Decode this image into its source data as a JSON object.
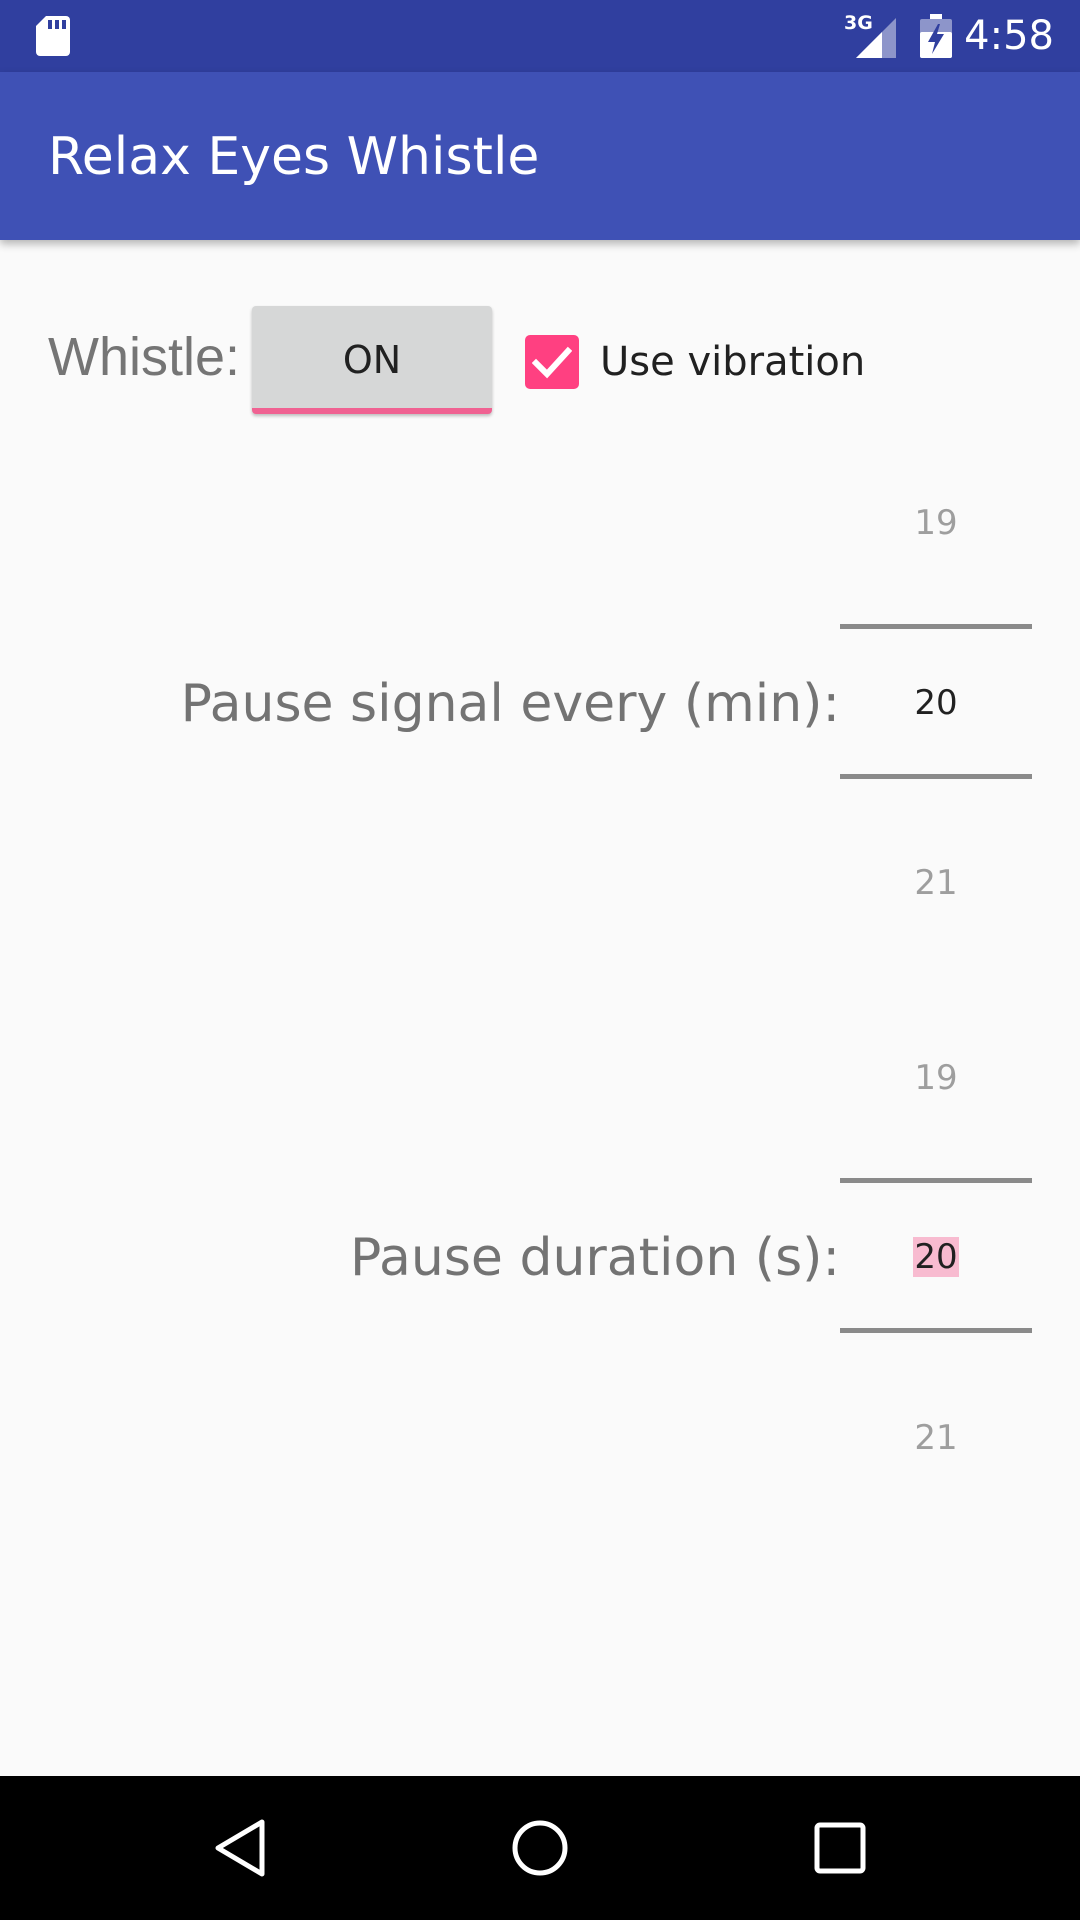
{
  "status_bar": {
    "time": "4:58",
    "network": "3G",
    "icons": [
      "sd-card-icon",
      "signal-icon",
      "battery-charging-icon"
    ]
  },
  "app_bar": {
    "title": "Relax Eyes Whistle"
  },
  "whistle": {
    "label": "Whistle:",
    "toggle_label": "ON",
    "vibration_label": "Use vibration",
    "vibration_checked": true
  },
  "pause_interval": {
    "label": "Pause signal every (min):",
    "prev": "19",
    "value": "20",
    "next": "21"
  },
  "pause_duration": {
    "label": "Pause duration (s):",
    "prev": "19",
    "value": "20",
    "next": "21"
  },
  "nav_bar": {
    "icons": [
      "back-icon",
      "home-icon",
      "recents-icon"
    ]
  },
  "colors": {
    "primary_dark": "#303f9f",
    "primary": "#3f51b5",
    "accent": "#ff4081",
    "background": "#fafafa"
  }
}
